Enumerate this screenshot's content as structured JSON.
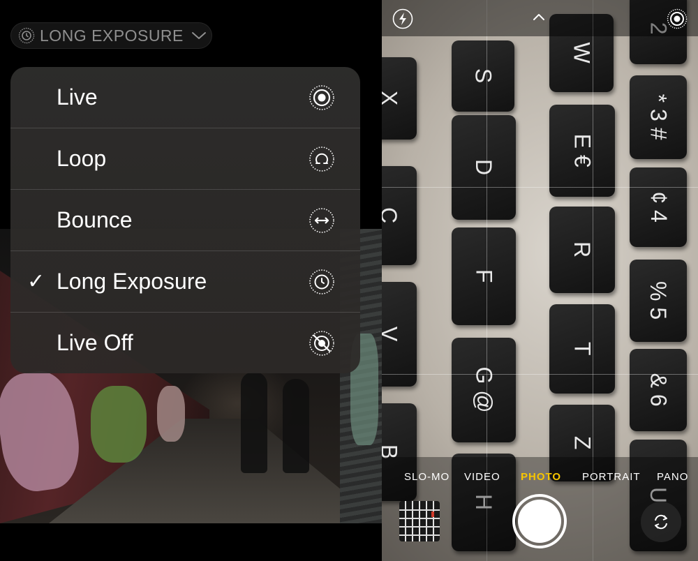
{
  "left_screen": {
    "exposure_pill": {
      "label": "LONG EXPOSURE",
      "icon": "long-exposure-icon"
    },
    "menu": {
      "items": [
        {
          "label": "Live",
          "icon": "live-icon",
          "selected": false
        },
        {
          "label": "Loop",
          "icon": "loop-icon",
          "selected": false
        },
        {
          "label": "Bounce",
          "icon": "bounce-icon",
          "selected": false
        },
        {
          "label": "Long Exposure",
          "icon": "long-exposure-icon",
          "selected": true
        },
        {
          "label": "Live Off",
          "icon": "live-off-icon",
          "selected": false
        }
      ],
      "check_mark": "✓"
    }
  },
  "right_screen": {
    "top_bar": {
      "flash_icon": "flash-off-icon",
      "caret_icon": "chevron-up-icon",
      "live_icon": "live-photo-icon"
    },
    "modes": [
      "SLO-MO",
      "VIDEO",
      "PHOTO",
      "PORTRAIT",
      "PANO"
    ],
    "active_mode": "PHOTO",
    "keys": [
      "S",
      "W",
      "X",
      "* 3 #",
      "2",
      "D",
      "E €",
      "C",
      "¢ 4",
      "R",
      "% 5",
      "F",
      "T",
      "V",
      "& 6",
      "G @",
      "Z",
      "B",
      "H",
      "U"
    ],
    "accent_color": "#f7c600"
  }
}
